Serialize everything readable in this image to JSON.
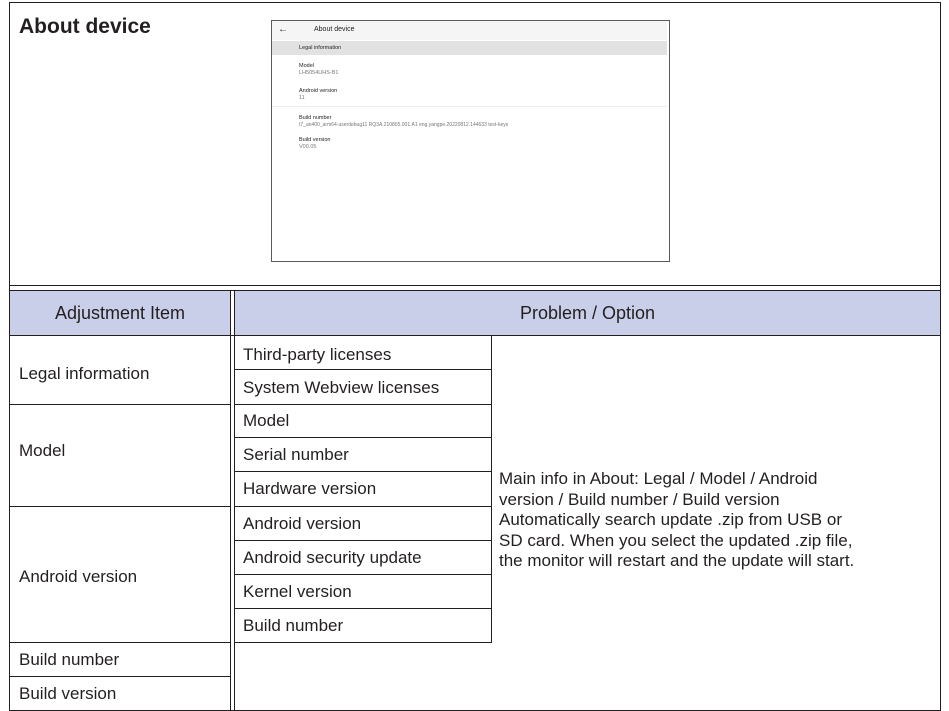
{
  "section": {
    "title": "About device"
  },
  "screen": {
    "back_icon": "←",
    "title": "About device",
    "legal_label": "Legal information",
    "items": [
      {
        "label": "Model",
        "value": "LH5054UHS-B1"
      },
      {
        "label": "Android version",
        "value": "11"
      },
      {
        "label": "Build number",
        "value": "t7_an400_arm64-userdebug11 RQ3A.210805.001.A1 eng.yangpe.20220812.144633 test-keys"
      },
      {
        "label": "Build version",
        "value": "V00.05"
      }
    ]
  },
  "table": {
    "header_left": "Adjustment Item",
    "header_right": "Problem / Option",
    "groups": [
      {
        "item": "Legal information",
        "options": [
          "Third-party licenses",
          "System Webview licenses"
        ]
      },
      {
        "item": "Model",
        "options": [
          "Model",
          "Serial number",
          "Hardware version"
        ]
      },
      {
        "item": "Android version",
        "options": [
          "Android version",
          "Android security update",
          "Kernel version",
          "Build number"
        ]
      }
    ],
    "solo_items": [
      "Build number",
      "Build version"
    ],
    "description": [
      "Main info in About: Legal / Model / Android",
      "version / Build number / Build version",
      "Automatically search update .zip from USB or",
      "SD card. When you select the updated .zip file,",
      "the monitor will restart and the update will start."
    ],
    "header_bg": "#c9cfe8"
  }
}
